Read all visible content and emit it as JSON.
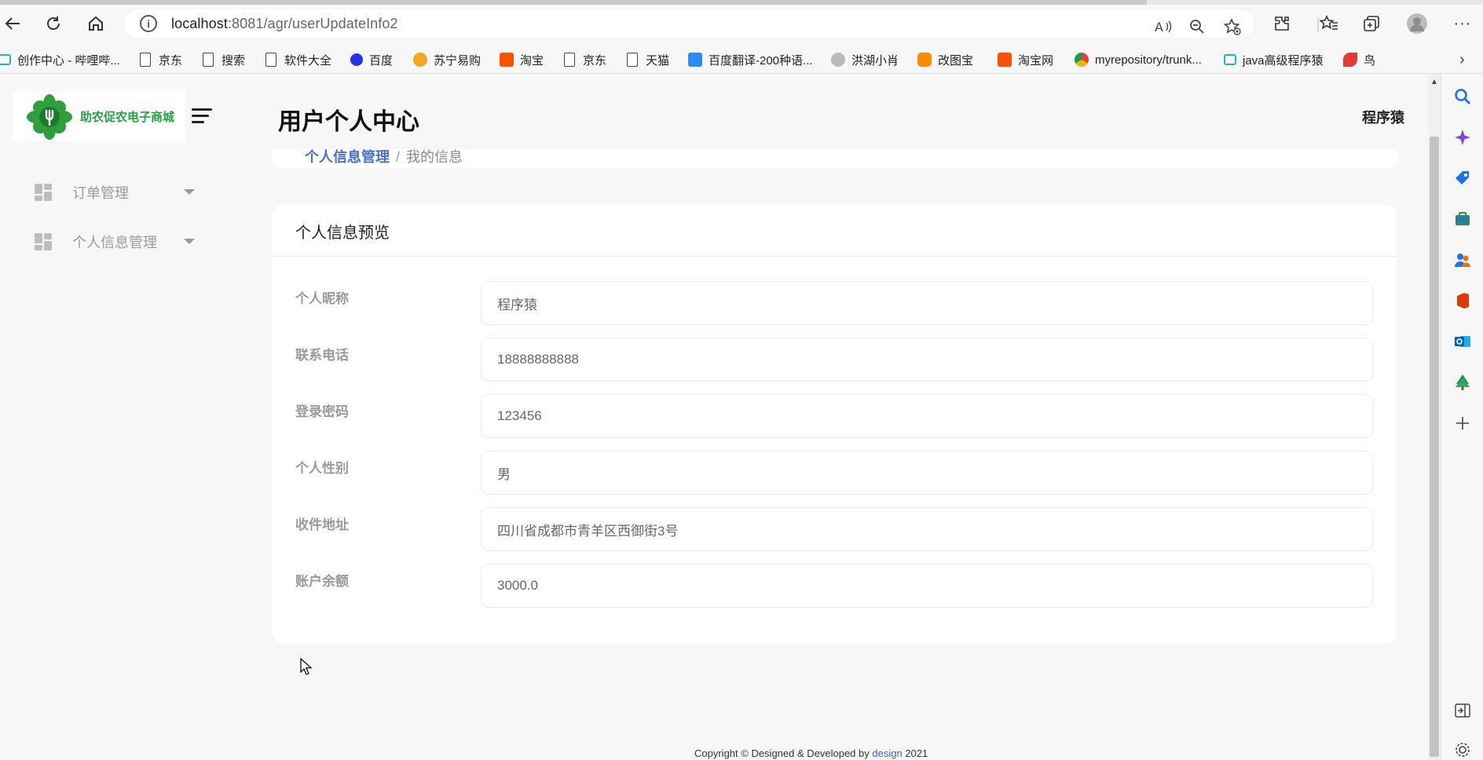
{
  "browser": {
    "url_host": "localhost",
    "url_rest": ":8081/agr/userUpdateInfo2",
    "bookmarks": [
      {
        "label": "创作中心 - 哔哩哔...",
        "icon": "bilibili-icon",
        "color": "#23ade5"
      },
      {
        "label": "京东",
        "icon": "page-icon"
      },
      {
        "label": "搜索",
        "icon": "page-icon"
      },
      {
        "label": "软件大全",
        "icon": "page-icon"
      },
      {
        "label": "百度",
        "icon": "baidu-icon",
        "color": "#2932e1"
      },
      {
        "label": "苏宁易购",
        "icon": "suning-icon",
        "color": "#f5a623"
      },
      {
        "label": "淘宝",
        "icon": "taobao-icon",
        "color": "#ff5000"
      },
      {
        "label": "京东",
        "icon": "page-icon"
      },
      {
        "label": "天猫",
        "icon": "page-icon"
      },
      {
        "label": "百度翻译-200种语...",
        "icon": "translate-icon",
        "color": "#2b8cf7"
      },
      {
        "label": "洪湖小肖",
        "icon": "bird-icon",
        "color": "#666666"
      },
      {
        "label": "改图宝",
        "icon": "gaitubao-icon",
        "color": "#ff8a00"
      },
      {
        "label": "淘宝网",
        "icon": "taobao-icon",
        "color": "#ff5000"
      },
      {
        "label": "myrepository/trunk...",
        "icon": "chrome-icon",
        "color": "#db4437"
      },
      {
        "label": "java高级程序猿",
        "icon": "bilibili-icon",
        "color": "#23ade5"
      },
      {
        "label": "鸟",
        "icon": "bird-red-icon",
        "color": "#e53935"
      }
    ]
  },
  "app": {
    "logo_text": "助农促农电子商城",
    "page_title": "用户个人中心",
    "user_name": "程序猿",
    "menu": [
      {
        "label": "订单管理"
      },
      {
        "label": "个人信息管理"
      }
    ],
    "breadcrumb": {
      "parent": "个人信息管理",
      "current": "我的信息"
    },
    "card_title": "个人信息预览",
    "fields": [
      {
        "label": "个人昵称",
        "value": "程序猿"
      },
      {
        "label": "联系电话",
        "value": "18888888888"
      },
      {
        "label": "登录密码",
        "value": "123456"
      },
      {
        "label": "个人性别",
        "value": "男"
      },
      {
        "label": "收件地址",
        "value": "四川省成都市青羊区西御街3号"
      },
      {
        "label": "账户余额",
        "value": "3000.0"
      }
    ],
    "footer": {
      "prefix": "Copyright © Designed & Developed by ",
      "link": "design",
      "suffix": " 2021"
    },
    "colors": {
      "brand_green": "#21a33d",
      "link_blue": "#3a65c9"
    }
  }
}
